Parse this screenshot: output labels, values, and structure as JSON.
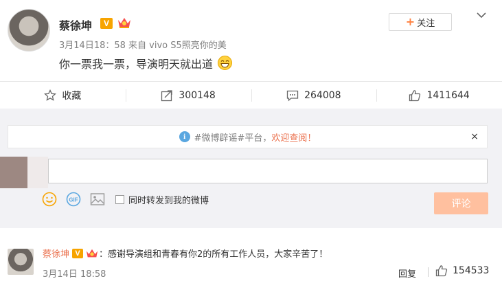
{
  "post": {
    "author": "蔡徐坤",
    "verified_badge": "V",
    "meta_time": "3月14日18：58 来自",
    "meta_device": "vivo S5照亮你的美",
    "text": "你一票我一票，导演明天就出道",
    "follow_label": "关注",
    "follow_plus": "+",
    "accent_color": "#ff8140"
  },
  "actions": {
    "favorite_label": "收藏",
    "repost_count": "300148",
    "comment_count": "264008",
    "like_count": "1411644"
  },
  "notice": {
    "info_glyph": "i",
    "prefix": "#微博辟谣#平台，",
    "highlight": "欢迎查阅！",
    "close_glyph": "×"
  },
  "composer": {
    "sync_label": "同时转发到我的微博",
    "submit_label": "评论",
    "gif_label": "GIF"
  },
  "comment": {
    "author": "蔡徐坤",
    "verified_badge": "V",
    "text": "：感谢导演组和青春有你2的所有工作人员，大家辛苦了！",
    "time": "3月14日 18:58",
    "reply_label": "回复",
    "like_count": "154533"
  }
}
